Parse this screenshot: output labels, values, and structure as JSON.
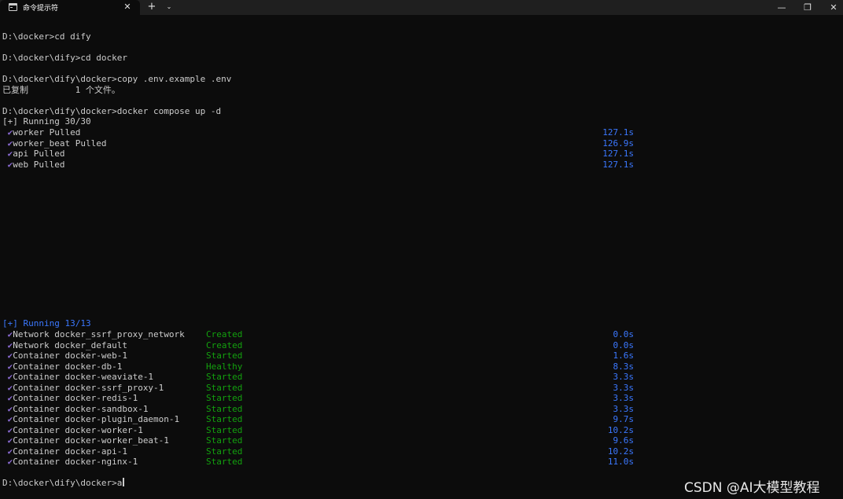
{
  "window": {
    "tab_title": "命令提示符",
    "tab_close": "✕",
    "new_tab": "+",
    "dropdown": "⌄",
    "minimize": "—",
    "maximize": "❐",
    "close": "✕",
    "icons": [
      "terminal-icon"
    ]
  },
  "terminal": {
    "prompts": [
      "D:\\docker>cd dify",
      "D:\\docker\\dify>cd docker",
      "D:\\docker\\dify\\docker>copy .env.example .env",
      "已复制         1 个文件。",
      "D:\\docker\\dify\\docker>docker compose up -d"
    ],
    "pull_header": "[+] Running 30/30",
    "pulled": [
      {
        "text": "worker Pulled",
        "time": "127.1s"
      },
      {
        "text": "worker_beat Pulled",
        "time": "126.9s"
      },
      {
        "text": "api Pulled",
        "time": "127.1s"
      },
      {
        "text": "web Pulled",
        "time": "127.1s"
      }
    ],
    "run_header": "[+] Running 13/13",
    "containers": [
      {
        "name": "Network docker_ssrf_proxy_network",
        "status": "Created",
        "time": "0.0s"
      },
      {
        "name": "Network docker_default",
        "status": "Created",
        "time": "0.0s"
      },
      {
        "name": "Container docker-web-1",
        "status": "Started",
        "time": "1.6s"
      },
      {
        "name": "Container docker-db-1",
        "status": "Healthy",
        "time": "8.3s"
      },
      {
        "name": "Container docker-weaviate-1",
        "status": "Started",
        "time": "3.3s"
      },
      {
        "name": "Container docker-ssrf_proxy-1",
        "status": "Started",
        "time": "3.3s"
      },
      {
        "name": "Container docker-redis-1",
        "status": "Started",
        "time": "3.3s"
      },
      {
        "name": "Container docker-sandbox-1",
        "status": "Started",
        "time": "3.3s"
      },
      {
        "name": "Container docker-plugin_daemon-1",
        "status": "Started",
        "time": "9.7s"
      },
      {
        "name": "Container docker-worker-1",
        "status": "Started",
        "time": "10.2s"
      },
      {
        "name": "Container docker-worker_beat-1",
        "status": "Started",
        "time": "9.6s"
      },
      {
        "name": "Container docker-api-1",
        "status": "Started",
        "time": "10.2s"
      },
      {
        "name": "Container docker-nginx-1",
        "status": "Started",
        "time": "11.0s"
      }
    ],
    "final_prompt": "D:\\docker\\dify\\docker>a",
    "check_glyph": "✔"
  },
  "watermark": "CSDN @AI大模型教程",
  "colors": {
    "background": "#0c0c0c",
    "text": "#cccccc",
    "blue": "#3b78ff",
    "green": "#13a10e",
    "check": "#8a6ad2"
  }
}
